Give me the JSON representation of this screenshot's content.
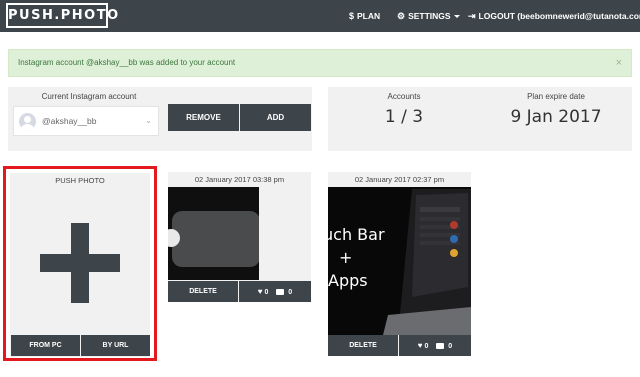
{
  "nav": {
    "logo": "PUSH.PHOTO",
    "plan": "PLAN",
    "settings": "SETTINGS",
    "logout": "LOGOUT (beebomnewerid@tutanota.com)",
    "bg": "#3d444a"
  },
  "alert": {
    "message": "Instagram account @akshay__bb was added to your account",
    "close": "×",
    "bg": "#dff0d8"
  },
  "account": {
    "label": "Current Instagram account",
    "selected": "@akshay__bb",
    "remove": "REMOVE",
    "add": "ADD"
  },
  "stats": {
    "accounts_label": "Accounts",
    "accounts_value": "1 / 3",
    "expire_label": "Plan expire date",
    "expire_value": "9 Jan 2017"
  },
  "push": {
    "title": "PUSH PHOTO",
    "from_pc": "FROM PC",
    "by_url": "BY URL",
    "highlight": "#e3191e"
  },
  "posts": [
    {
      "date": "02 January 2017 03:38 pm",
      "delete": "DELETE",
      "likes": "0",
      "comments": "0"
    },
    {
      "date": "02 January 2017 02:37 pm",
      "delete": "DELETE",
      "likes": "0",
      "comments": "0",
      "image_text": [
        "uch Bar",
        "+",
        "Apps"
      ]
    }
  ]
}
